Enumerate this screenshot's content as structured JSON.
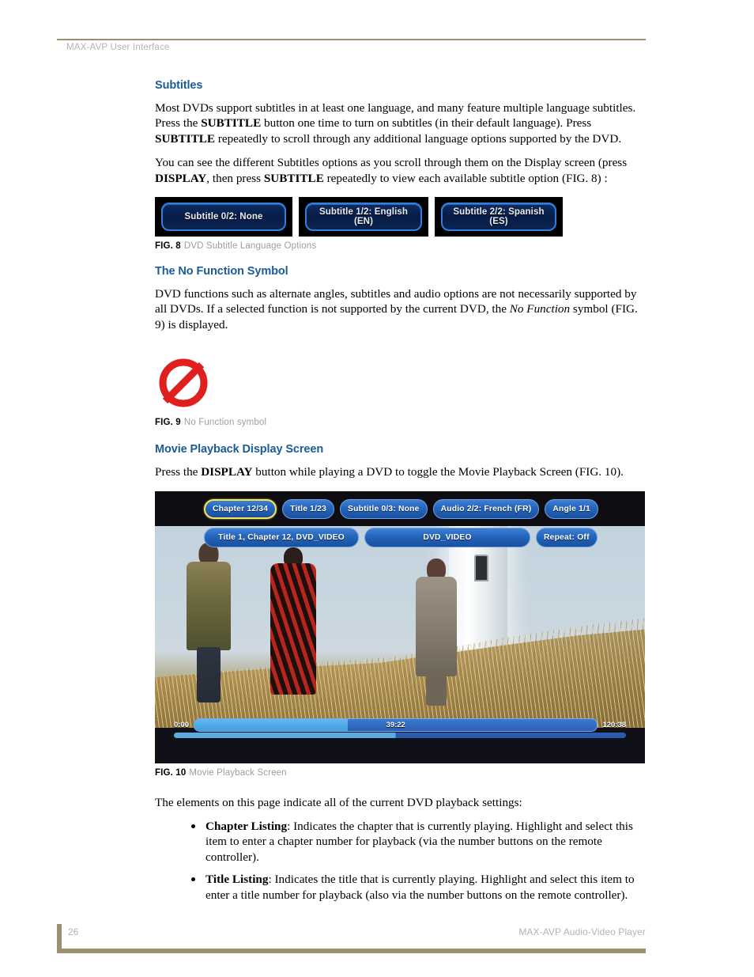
{
  "header": {
    "running_title": "MAX-AVP User Interface"
  },
  "sections": {
    "subtitles": {
      "heading": "Subtitles",
      "para1_a": "Most DVDs support subtitles in at least one language, and many feature multiple language subtitles. Press the ",
      "para1_b": "SUBTITLE",
      "para1_c": " button one time to turn on subtitles (in their default language). Press ",
      "para1_d": "SUBTITLE",
      "para1_e": " repeatedly to scroll through any additional language options supported by the DVD.",
      "para2_a": "You can see the different Subtitles options as you scroll through them on the Display screen (press ",
      "para2_b": "DISPLAY",
      "para2_c": ", then press ",
      "para2_d": "SUBTITLE",
      "para2_e": " repeatedly to view each available subtitle option (FIG. 8) :"
    },
    "no_function": {
      "heading": "The No Function Symbol",
      "para_a": "DVD functions such as alternate angles, subtitles and audio options are not necessarily supported by all DVDs. If a selected function is not supported by the current DVD, the ",
      "para_b": "No Function",
      "para_c": " symbol (FIG. 9) is displayed."
    },
    "movie_playback": {
      "heading": "Movie Playback Display Screen",
      "para_a": "Press the ",
      "para_b": "DISPLAY",
      "para_c": " button while playing a DVD to toggle the Movie Playback Screen (FIG. 10).",
      "intro": "The elements on this page indicate all of the current DVD playback settings:",
      "bullets": [
        {
          "term": "Chapter Listing",
          "text": ": Indicates the chapter that is currently playing. Highlight and select this item to enter a chapter number for playback (via the number buttons on the remote controller)."
        },
        {
          "term": "Title Listing",
          "text": ": Indicates the title that is currently playing. Highlight and select this item to enter a title number for playback (also via the number buttons on the remote controller)."
        }
      ]
    }
  },
  "figures": {
    "fig8": {
      "label": "FIG. 8",
      "caption": "DVD Subtitle Language Options",
      "buttons": [
        {
          "text": "Subtitle 0/2: None"
        },
        {
          "text": "Subtitle 1/2: English\n(EN)"
        },
        {
          "text": "Subtitle 2/2: Spanish\n(ES)"
        }
      ]
    },
    "fig9": {
      "label": "FIG. 9",
      "caption": "No Function symbol",
      "icon": "no-function-symbol",
      "color": "#e02020"
    },
    "fig10": {
      "label": "FIG. 10",
      "caption": "Movie Playback Screen",
      "osd_row_1": [
        {
          "text": "Chapter 12/34",
          "selected": true
        },
        {
          "text": "Title 1/23",
          "selected": false
        },
        {
          "text": "Subtitle 0/3: None",
          "selected": false
        },
        {
          "text": "Audio 2/2: French (FR)",
          "selected": false
        },
        {
          "text": "Angle 1/1",
          "selected": false
        }
      ],
      "osd_row_2": [
        {
          "text": "Title 1, Chapter 12, DVD_VIDEO",
          "selected": false
        },
        {
          "text": "DVD_VIDEO",
          "selected": false
        },
        {
          "text": "Repeat: Off",
          "selected": false
        }
      ],
      "progress": {
        "start": "0:00",
        "current": "39:22",
        "end": "120:38",
        "percent": 38
      }
    }
  },
  "footer": {
    "page_number": "26",
    "product": "MAX-AVP Audio-Video Player"
  },
  "colors": {
    "heading_blue": "#1b5b97",
    "rule_tan": "#9b8f6e",
    "caption_gray": "#9d9d9d",
    "osd_blue": "#2566bd",
    "osd_selected_border": "#f2e85a",
    "no_function_red": "#e02020"
  }
}
